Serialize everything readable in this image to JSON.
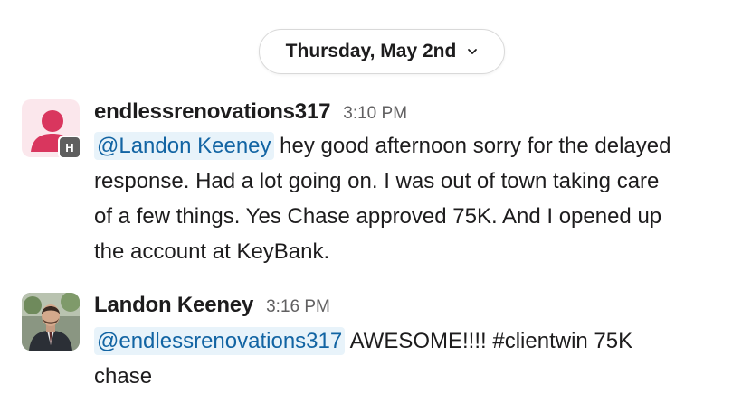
{
  "date_divider": {
    "label": "Thursday, May 2nd"
  },
  "messages": [
    {
      "sender": "endlessrenovations317",
      "time": "3:10 PM",
      "badge": "H",
      "mention": "@Landon Keeney",
      "text_line1": " hey good afternoon sorry for the delayed",
      "text_line2": "response. Had a lot going on. I was out of town taking care",
      "text_line3": "of a few things. Yes Chase approved 75K.  And I opened up",
      "text_line4": "the account at KeyBank."
    },
    {
      "sender": "Landon Keeney",
      "time": "3:16 PM",
      "mention": "@endlessrenovations317",
      "text_line1": " AWESOME!!!! #clientwin 75K",
      "text_line2": "chase"
    }
  ],
  "colors": {
    "mention_bg": "#e8f3fa",
    "mention_text": "#1264a3",
    "generic_avatar": "#d9365e",
    "badge_bg": "#5e5e5e"
  }
}
